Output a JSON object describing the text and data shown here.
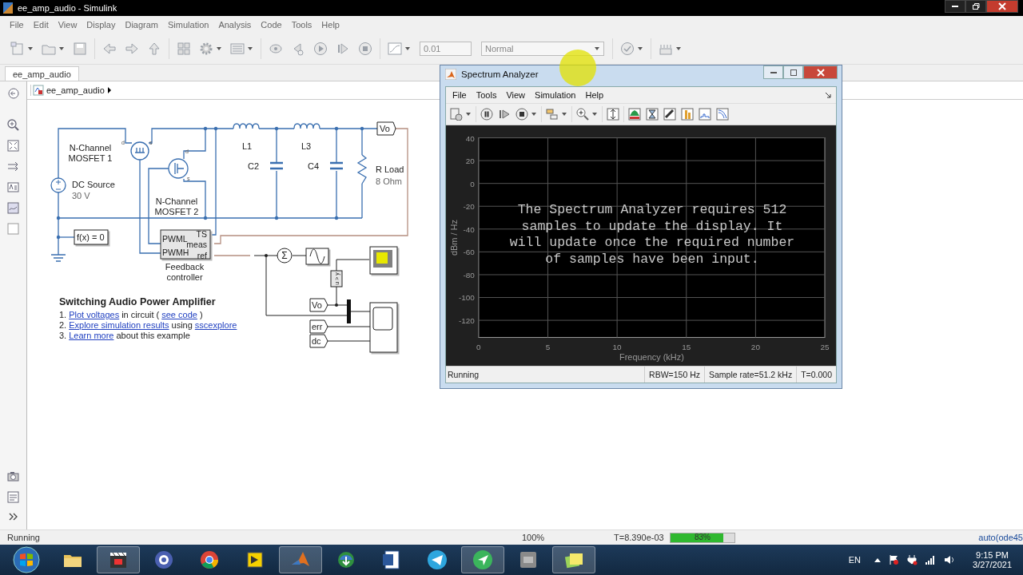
{
  "window": {
    "title": "ee_amp_audio - Simulink"
  },
  "menu": [
    "File",
    "Edit",
    "View",
    "Display",
    "Diagram",
    "Simulation",
    "Analysis",
    "Code",
    "Tools",
    "Help"
  ],
  "toolbar": {
    "stop_time": "0.01",
    "mode": "Normal"
  },
  "tabs": [
    {
      "label": "ee_amp_audio",
      "selected": true
    }
  ],
  "breadcrumb": "ee_amp_audio",
  "diagram": {
    "labels": [
      {
        "lines": [
          "N-Channel",
          "MOSFET 1"
        ]
      },
      {
        "lines": [
          "d"
        ]
      },
      {
        "lines": [
          "s"
        ]
      },
      {
        "lines": [
          "L1"
        ]
      },
      {
        "lines": [
          "L3"
        ]
      },
      {
        "lines": [
          "d"
        ]
      },
      {
        "lines": [
          "C2"
        ]
      },
      {
        "lines": [
          "C4"
        ]
      },
      {
        "lines": [
          "R Load"
        ]
      },
      {
        "lines": [
          "s"
        ]
      },
      {
        "lines": [
          "8 Ohm"
        ]
      },
      {
        "lines": [
          "DC Source"
        ]
      },
      {
        "lines": [
          "30 V"
        ]
      },
      {
        "lines": [
          "N-Channel",
          "MOSFET 2"
        ]
      },
      {
        "lines": [
          "Σ"
        ]
      },
      {
        "lines": [
          "Feedback",
          "controller"
        ]
      },
      {
        "lines": [
          "u > y"
        ]
      }
    ],
    "goto_tag": "Vo",
    "constraint": "f(x) = 0",
    "controller": {
      "inputs": [
        "PWML",
        "PWMH"
      ],
      "outputs": [
        "TS",
        "meas",
        "ref"
      ]
    },
    "from_tags": [
      "Vo",
      "err",
      "dc"
    ]
  },
  "description": {
    "title": "Switching Audio Power Amplifier",
    "items": [
      {
        "number": "1.",
        "parts": [
          {
            "kind": "link",
            "text": "Plot voltages"
          },
          {
            "kind": "text",
            "text": "in circuit ("
          },
          {
            "kind": "link",
            "text": "see code"
          },
          {
            "kind": "text",
            "text": ")"
          }
        ]
      },
      {
        "number": "2.",
        "parts": [
          {
            "kind": "link",
            "text": "Explore simulation results"
          },
          {
            "kind": "text",
            "text": "using"
          },
          {
            "kind": "link",
            "text": "sscexplore"
          }
        ]
      },
      {
        "number": "3.",
        "parts": [
          {
            "kind": "link",
            "text": "Learn more"
          },
          {
            "kind": "text",
            "text": "about this example"
          }
        ]
      }
    ]
  },
  "spectrum_analyzer": {
    "title": "Spectrum Analyzer",
    "menu": [
      "File",
      "Tools",
      "View",
      "Simulation",
      "Help"
    ],
    "message": "The Spectrum Analyzer requires 512 samples to update the display. It will update once the required number of samples have been input.",
    "chart_data": {
      "type": "line",
      "xlabel": "Frequency (kHz)",
      "ylabel": "dBm / Hz",
      "xlim": [
        0,
        25
      ],
      "ylim": [
        -135,
        40
      ],
      "grid": true,
      "xticks": [
        0,
        5,
        10,
        15,
        20,
        25
      ],
      "yticks": [
        40,
        20,
        0,
        -20,
        -40,
        -60,
        -80,
        -100,
        -120
      ]
    },
    "status": "Running",
    "fields": [
      "RBW=150 Hz",
      "Sample rate=51.2 kHz",
      "T=0.000"
    ]
  },
  "status_bar": {
    "state": "Running",
    "zoom": "100%",
    "time": "T=8.390e-03",
    "progress": {
      "level": 0.83,
      "label": "83%"
    },
    "solver": "auto(ode45"
  },
  "taskbar": {
    "apps": [
      {
        "kind": "folder",
        "active": false
      },
      {
        "kind": "clapperboard",
        "active": true
      },
      {
        "kind": "globe",
        "active": false
      },
      {
        "kind": "browser",
        "active": false
      },
      {
        "kind": "yellow",
        "active": false
      },
      {
        "kind": "peak",
        "active": true
      },
      {
        "kind": "download",
        "active": false
      },
      {
        "kind": "document",
        "active": false
      },
      {
        "kind": "plane",
        "active": false
      },
      {
        "kind": "arrow",
        "active": true
      },
      {
        "kind": "grey",
        "active": false
      },
      {
        "kind": "notes",
        "active": true
      }
    ],
    "language": "EN",
    "time": "9:15 PM",
    "date": "3/27/2021"
  }
}
